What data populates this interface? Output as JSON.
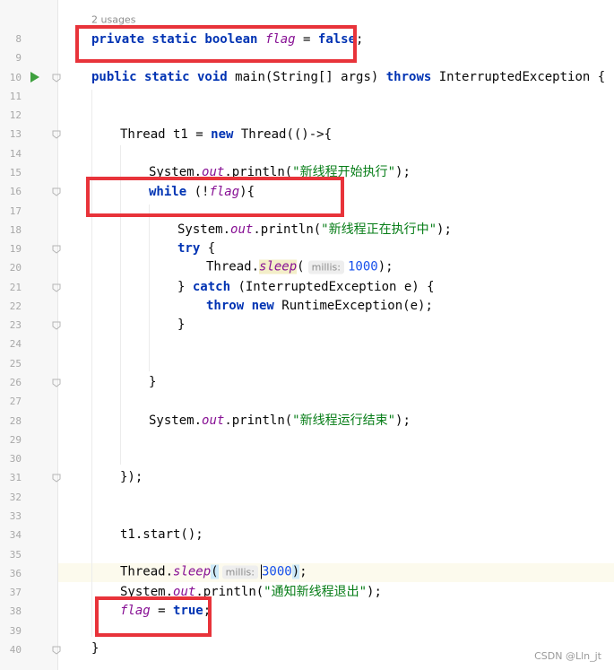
{
  "editor": {
    "usages_hint": "2 usages",
    "param_hint": "millis:",
    "watermark": "CSDN @Lln_jt"
  },
  "line_numbers": [
    "8",
    "9",
    "10",
    "11",
    "12",
    "13",
    "14",
    "15",
    "16",
    "17",
    "18",
    "19",
    "20",
    "21",
    "22",
    "23",
    "24",
    "25",
    "26",
    "27",
    "28",
    "29",
    "30",
    "31",
    "32",
    "33",
    "34",
    "35",
    "36",
    "37",
    "38",
    "39",
    "40"
  ],
  "code": {
    "l8": {
      "kw1": "private static boolean ",
      "field": "flag",
      "op": " = ",
      "kw2": "false",
      ";": ";"
    },
    "l10": {
      "kw1": "public static void ",
      "rest1": "main(String[] args) ",
      "kw2": "throws ",
      "rest2": "InterruptedException {"
    },
    "l13": {
      "rest1": "Thread t1 = ",
      "kw": "new ",
      "rest2": "Thread(()->{"
    },
    "l15": {
      "p1": "System.",
      "out": "out",
      "p2": ".println(",
      "str": "\"新线程开始执行\"",
      "p3": ");"
    },
    "l16": {
      "kw": "while ",
      "p1": "(!",
      "field": "flag",
      "p2": "){"
    },
    "l18": {
      "p1": "System.",
      "out": "out",
      "p2": ".println(",
      "str": "\"新线程正在执行中\"",
      "p3": ");"
    },
    "l19": {
      "kw": "try ",
      "p1": "{"
    },
    "l20": {
      "p1": "Thread.",
      "sleep": "sleep",
      "p2": "(",
      "num": "1000",
      "p3": ");"
    },
    "l21": {
      "p1": "} ",
      "kw": "catch ",
      "p2": "(InterruptedException e) {"
    },
    "l22": {
      "kw1": "throw ",
      "kw2": "new ",
      "p1": "RuntimeException(e);"
    },
    "l23": {
      "p1": "}"
    },
    "l26": {
      "p1": "}"
    },
    "l28": {
      "p1": "System.",
      "out": "out",
      "p2": ".println(",
      "str": "\"新线程运行结束\"",
      "p3": ");"
    },
    "l31": {
      "p1": "});"
    },
    "l34": {
      "p1": "t1.start();"
    },
    "l36": {
      "p1": "Thread.",
      "sleep": "sleep",
      "p2": "(",
      "num": "3000",
      "p3": ")",
      ";": ";"
    },
    "l37": {
      "p1": "System.",
      "out": "out",
      "p2": ".println(",
      "str": "\"通知新线程退出\"",
      "p3": ");"
    },
    "l38": {
      "field": "flag",
      "op": " = ",
      "kw": "true",
      ";": ";"
    },
    "l40": {
      "p1": "}"
    }
  },
  "colors": {
    "keyword": "#0033b3",
    "field": "#871094",
    "string": "#067d17",
    "number": "#1750eb",
    "annotation_box": "#e8333a",
    "run_icon": "#3ea03e"
  },
  "icons": {
    "run": "run-gutter-icon",
    "fold": "fold-marker-icon"
  }
}
